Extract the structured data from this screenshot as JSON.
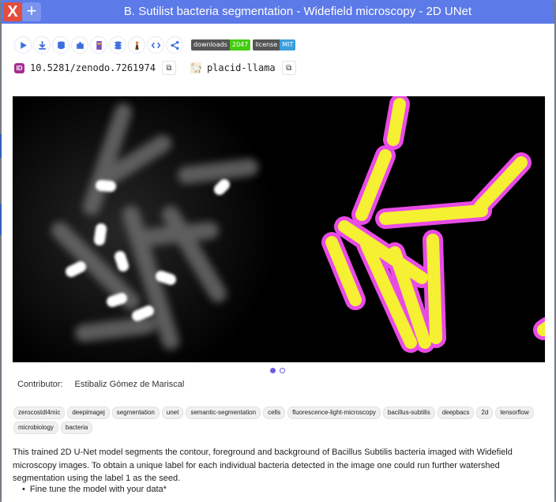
{
  "window": {
    "title": "B. Sutilist bacteria segmentation - Widefield microscopy - 2D UNet",
    "close_label": "X",
    "expand_label": "+"
  },
  "toolbar": {
    "buttons": [
      {
        "icon": "play-icon"
      },
      {
        "icon": "download-icon"
      },
      {
        "icon": "database-icon"
      },
      {
        "icon": "puzzle-icon"
      },
      {
        "icon": "notebook-icon"
      },
      {
        "icon": "stack-icon"
      },
      {
        "icon": "ilastik-icon"
      },
      {
        "icon": "code-icon"
      },
      {
        "icon": "share-icon"
      }
    ],
    "badges": [
      {
        "label": "downloads",
        "value": "2047",
        "color": "#4c1"
      },
      {
        "label": "license",
        "value": "MIT",
        "color": "#3a9fdc"
      }
    ]
  },
  "ids": {
    "doi": "10.5281/zenodo.7261974",
    "nickname": "placid-llama",
    "copy_glyph": "⧉"
  },
  "gallery": {
    "active_slide": 0,
    "slide_count": 2
  },
  "contributor": {
    "label": "Contributor:",
    "name": "Estibaliz Gómez de Mariscal"
  },
  "tags": [
    "zerocostdl4mic",
    "deepimagej",
    "segmentation",
    "unet",
    "semantic-segmentation",
    "cells",
    "fluorescence-light-microscopy",
    "bacillus-subtilis",
    "deepbacs",
    "2d",
    "tensorflow",
    "microbiology",
    "bacteria"
  ],
  "description": {
    "text": "This trained 2D U-Net model segments the contour, foreground and background of Bacillus Subtilis bacteria imaged with Widefield microscopy images. To obtain a unique label for each individual bacteria detected in the image one could run further watershed segmentation using the label 1 as the seed.",
    "bullet": "Fine tune the model with your data*"
  },
  "colors": {
    "titlebar": "#5c7ae8",
    "close": "#e34d3c",
    "accent": "#6a5ee0",
    "mask_fill": "#f5f032",
    "mask_contour": "#e94be6"
  }
}
